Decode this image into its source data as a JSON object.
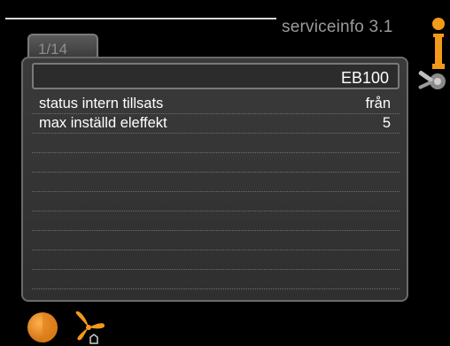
{
  "header": {
    "title": "serviceinfo 3.1"
  },
  "tab": {
    "label": "1/14"
  },
  "section": {
    "title": "EB100"
  },
  "rows": [
    {
      "label": "status intern tillsats",
      "value": "från"
    },
    {
      "label": "max inställd eleffekt",
      "value": "5"
    },
    {
      "label": "",
      "value": ""
    },
    {
      "label": "",
      "value": ""
    },
    {
      "label": "",
      "value": ""
    },
    {
      "label": "",
      "value": ""
    },
    {
      "label": "",
      "value": ""
    },
    {
      "label": "",
      "value": ""
    },
    {
      "label": "",
      "value": ""
    },
    {
      "label": "",
      "value": ""
    },
    {
      "label": "",
      "value": ""
    }
  ],
  "icons": {
    "info": "info-icon",
    "tools": "tools-icon",
    "home": "home-icon",
    "fan": "fan-icon"
  },
  "colors": {
    "accent": "#f39a1a",
    "panel": "#333333",
    "header_text": "#9a9a9a"
  }
}
